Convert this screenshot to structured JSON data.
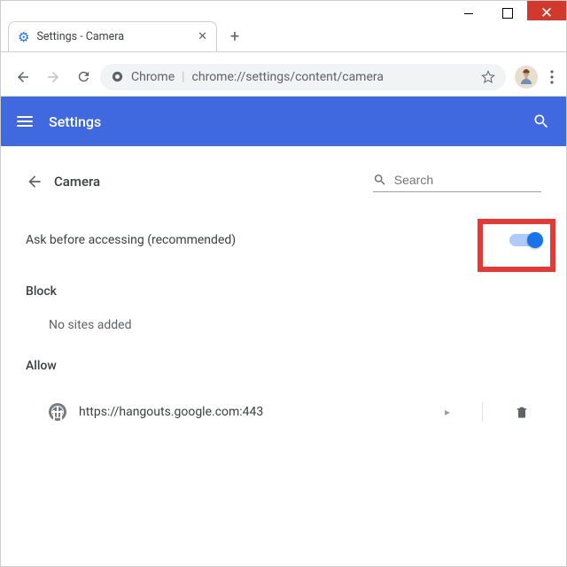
{
  "window": {
    "tab_title": "Settings - Camera"
  },
  "addressbar": {
    "scheme_label": "Chrome",
    "url": "chrome://settings/content/camera"
  },
  "header": {
    "title": "Settings"
  },
  "subheader": {
    "title": "Camera",
    "search_placeholder": "Search"
  },
  "setting": {
    "label": "Ask before accessing (recommended)",
    "enabled": true
  },
  "sections": {
    "block": {
      "title": "Block",
      "empty_text": "No sites added"
    },
    "allow": {
      "title": "Allow",
      "sites": [
        {
          "url": "https://hangouts.google.com:443"
        }
      ]
    }
  }
}
